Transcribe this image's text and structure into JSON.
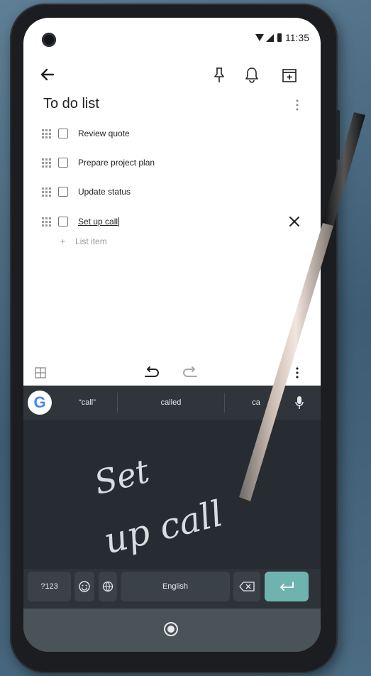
{
  "status_bar": {
    "time": "11:35"
  },
  "note": {
    "title": "To do list",
    "items": [
      {
        "text": "Review quote",
        "checked": false
      },
      {
        "text": "Prepare project plan",
        "checked": false
      },
      {
        "text": "Update status",
        "checked": false
      },
      {
        "text": "Set up call",
        "checked": false,
        "editing": true
      }
    ],
    "add_item_label": "List item"
  },
  "icons": {
    "back": "back-arrow-icon",
    "pin": "pin-icon",
    "reminder": "bell-icon",
    "archive": "archive-icon",
    "more": "more-vert-icon",
    "delete_item": "close-icon",
    "add": "plus-icon",
    "grid": "grid-icon",
    "undo": "undo-icon",
    "redo": "redo-icon"
  },
  "keyboard": {
    "suggestions": [
      "“call”",
      "called",
      "ca"
    ],
    "handwriting": [
      "Set",
      "up call"
    ],
    "keys": {
      "symbols": "?123",
      "language": "English"
    },
    "accent_color": "#6fb3ae"
  }
}
